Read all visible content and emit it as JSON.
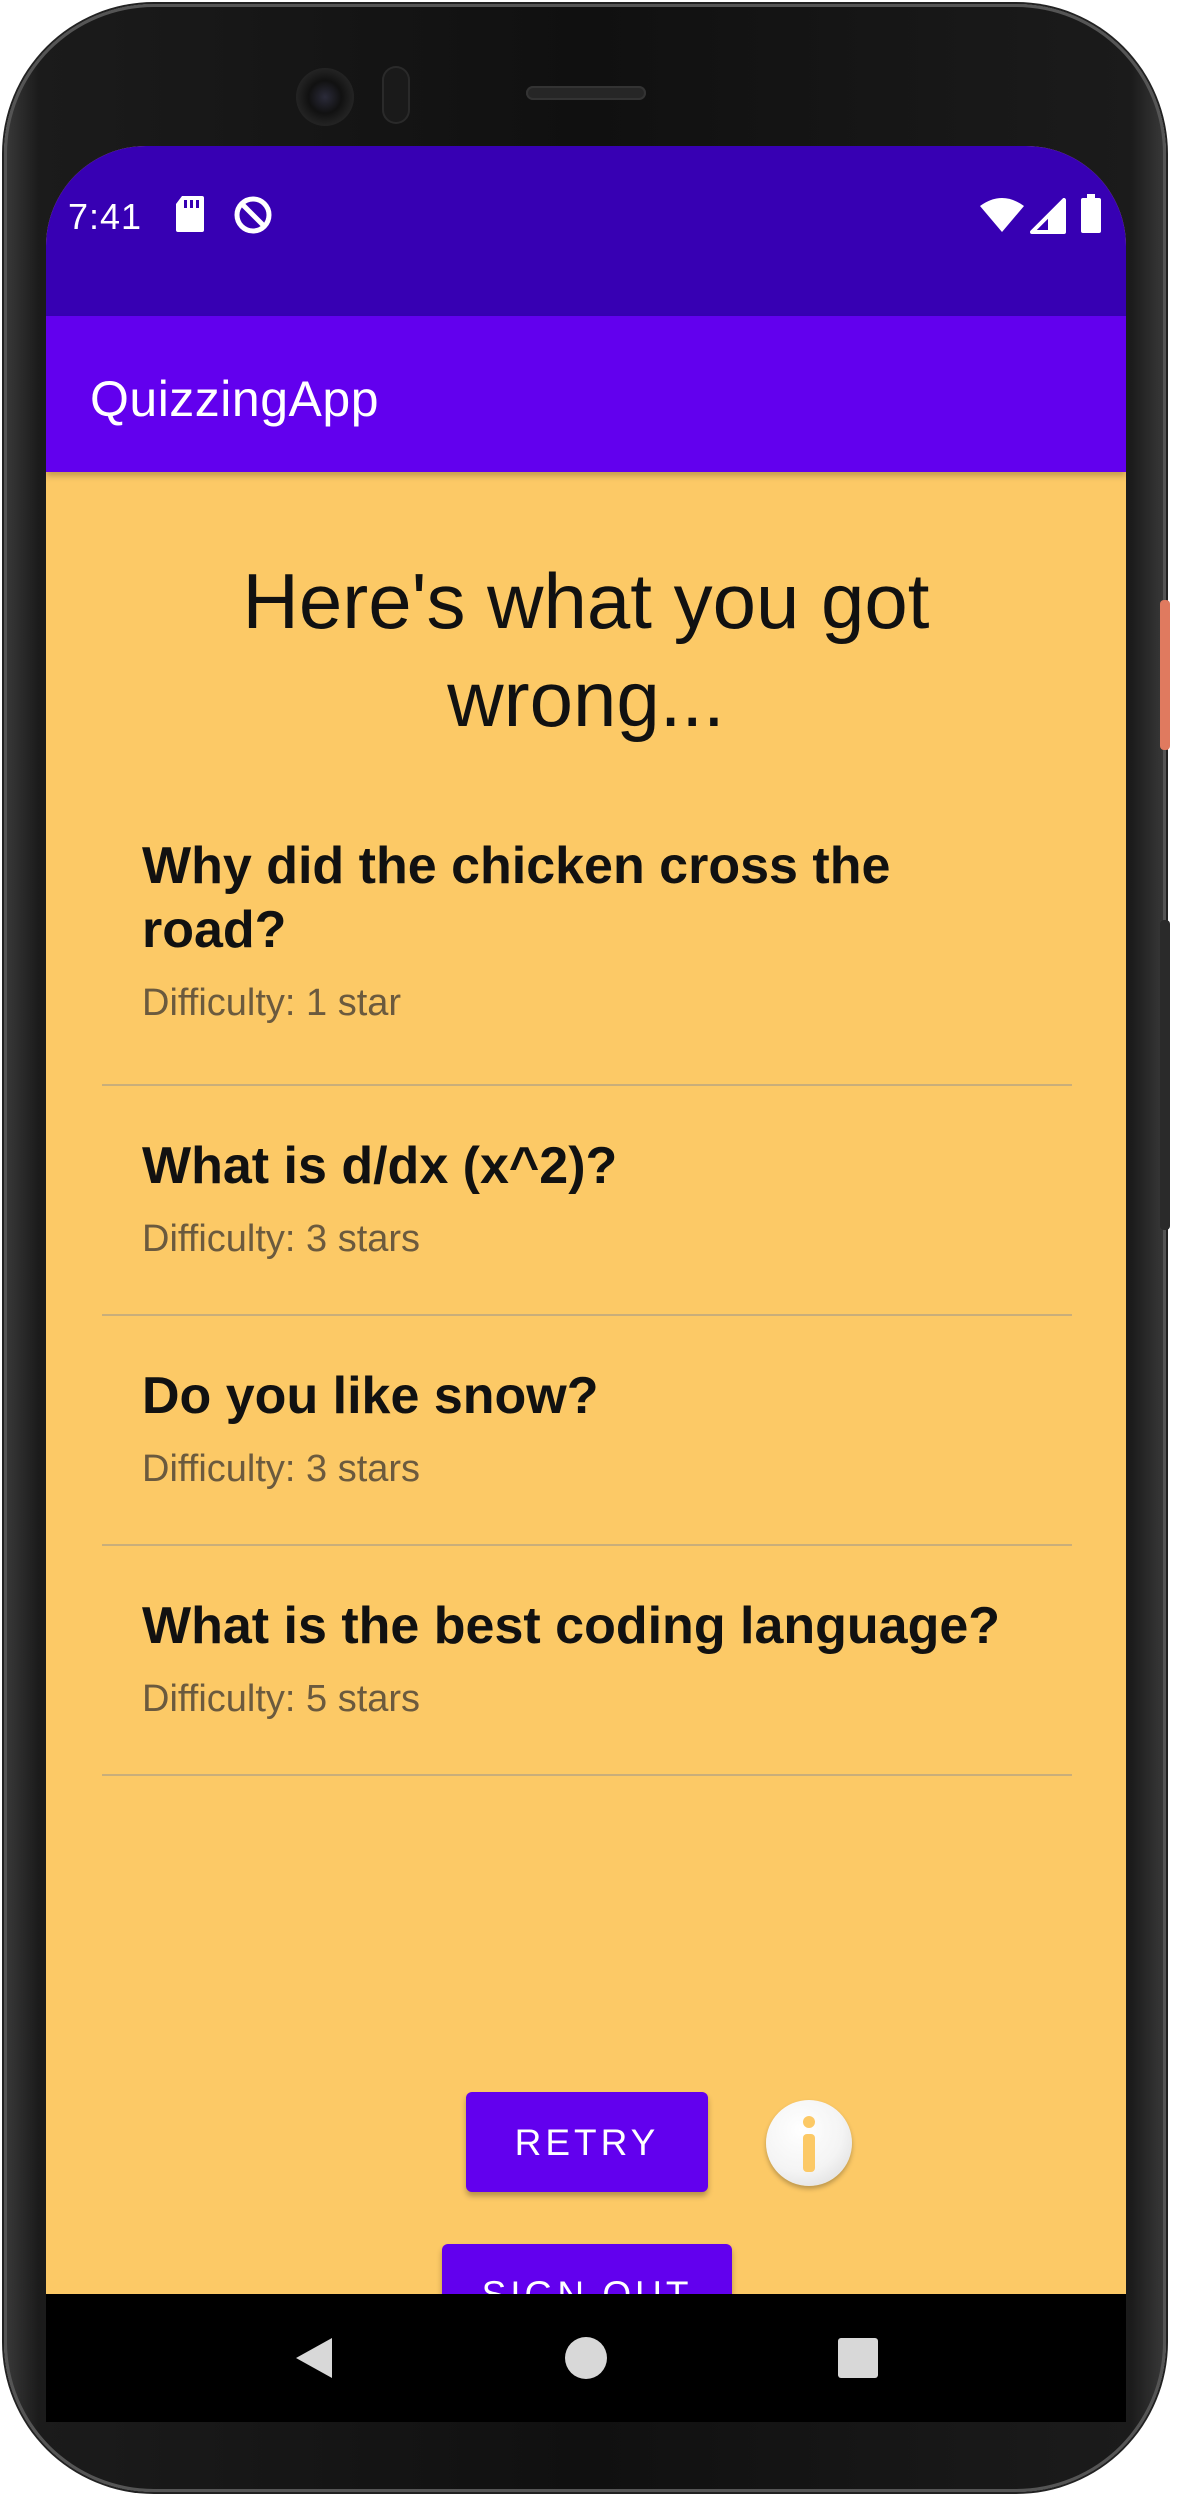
{
  "status_bar": {
    "time": "7:41",
    "icons_left": [
      "sd-card-icon",
      "data-saver-icon"
    ],
    "icons_right": [
      "wifi-icon",
      "cell-signal-icon",
      "battery-icon"
    ],
    "color": "#3700B3"
  },
  "app_bar": {
    "title": "QuizzingApp",
    "color": "#6200EE"
  },
  "main": {
    "heading": "Here's what you got wrong...",
    "background": "#FCC966",
    "wrong_questions": [
      {
        "question": "Why did the chicken cross the road?",
        "difficulty": "Difficulty: 1 star",
        "stars": 1
      },
      {
        "question": "What is d/dx (x^2)?",
        "difficulty": "Difficulty: 3 stars",
        "stars": 3
      },
      {
        "question": "Do you like snow?",
        "difficulty": "Difficulty: 3 stars",
        "stars": 3
      },
      {
        "question": "What is the best coding language?",
        "difficulty": "Difficulty: 5 stars",
        "stars": 5
      }
    ],
    "retry_label": "RETRY",
    "sign_out_label": "SIGN OUT",
    "info_icon": "info-icon"
  },
  "nav_bar": {
    "buttons": [
      "back-icon",
      "home-icon",
      "recents-icon"
    ]
  }
}
